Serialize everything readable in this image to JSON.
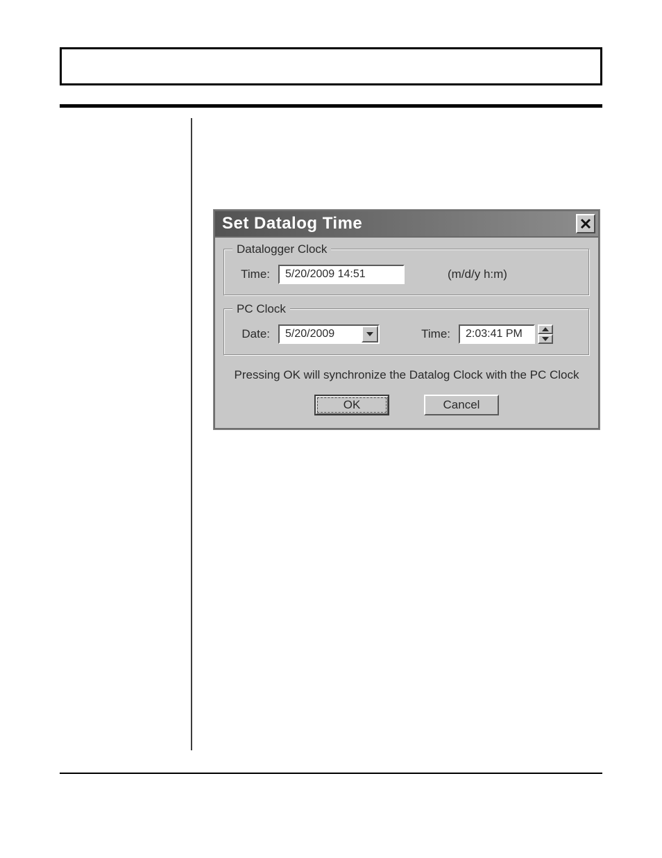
{
  "dialog": {
    "title": "Set Datalog Time",
    "group1": {
      "legend": "Datalogger Clock",
      "time_label": "Time:",
      "time_value": "5/20/2009 14:51",
      "format_hint": "(m/d/y h:m)"
    },
    "group2": {
      "legend": "PC Clock",
      "date_label": "Date:",
      "date_value": "5/20/2009",
      "time_label": "Time:",
      "time_value": "2:03:41 PM"
    },
    "instruction": "Pressing OK will synchronize the Datalog Clock with the PC Clock",
    "ok_label": "OK",
    "cancel_label": "Cancel"
  }
}
